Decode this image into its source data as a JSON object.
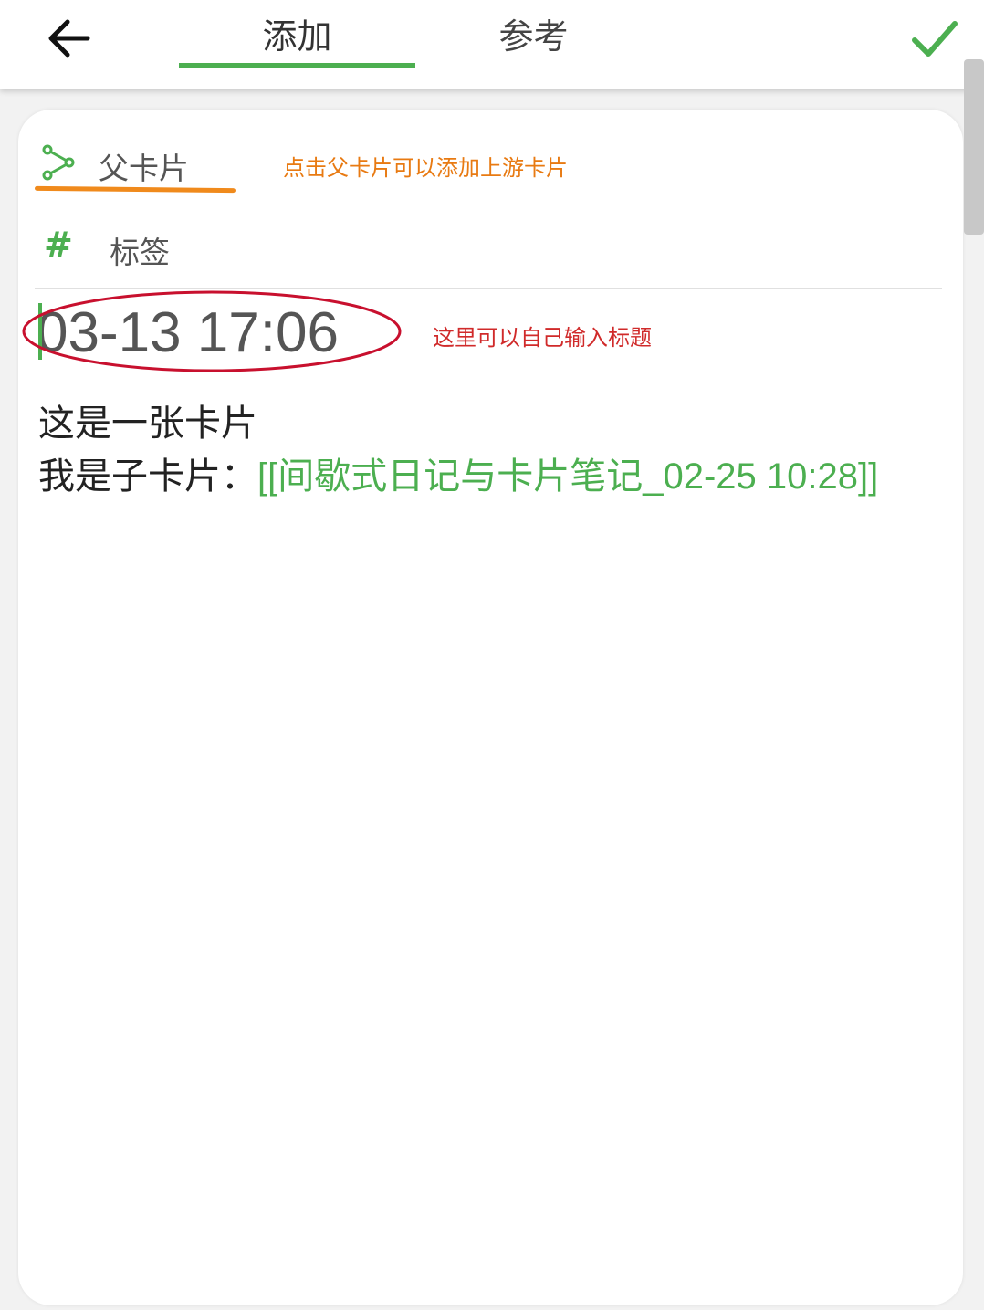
{
  "header": {
    "tabs": [
      {
        "label": "添加",
        "active": true
      },
      {
        "label": "参考",
        "active": false
      }
    ],
    "back_icon": "arrow-left-icon",
    "confirm_icon": "check-icon"
  },
  "card": {
    "parent_label": "父卡片",
    "parent_icon": "share-icon",
    "parent_note": "点击父卡片可以添加上游卡片",
    "tag_label": "标签",
    "tag_icon": "#",
    "title_value": "03-13 17:06",
    "title_note": "这里可以自己输入标题",
    "body_line1": "这是一张卡片",
    "body_line2_prefix": "我是子卡片：",
    "body_link": "[[间歇式日记与卡片笔记_02-25 10:28]]"
  },
  "colors": {
    "accent": "#4caf50",
    "annotation_orange": "#e87a12",
    "annotation_red": "#d02a2a"
  }
}
